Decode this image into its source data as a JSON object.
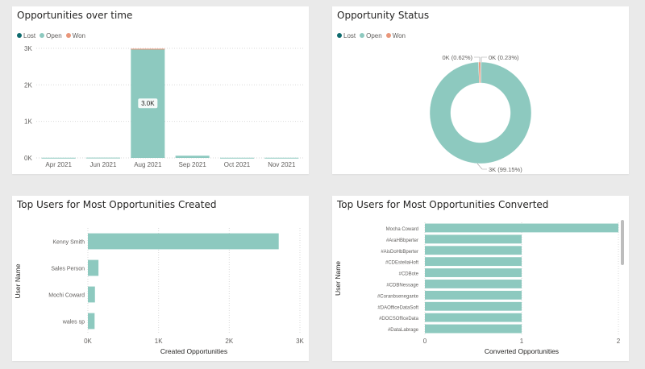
{
  "colors": {
    "lost": "#0e6b6e",
    "open": "#8dc9bf",
    "won": "#e9967a",
    "grid": "#d9d9d9",
    "axis_text": "#605e5c"
  },
  "cards": {
    "opportunities_over_time": {
      "title": "Opportunities over time"
    },
    "opportunity_status": {
      "title": "Opportunity Status"
    },
    "top_created": {
      "title": "Top Users for Most Opportunities Created"
    },
    "top_converted": {
      "title": "Top Users for Most Opportunities Converted"
    }
  },
  "legend": {
    "lost": "Lost",
    "open": "Open",
    "won": "Won"
  },
  "chart_data": [
    {
      "type": "bar",
      "title": "Opportunities over time",
      "categories": [
        "Apr 2021",
        "Jun 2021",
        "Aug 2021",
        "Sep 2021",
        "Oct 2021",
        "Nov 2021"
      ],
      "series": [
        {
          "name": "Lost",
          "values": [
            0,
            0,
            0,
            0,
            0,
            0
          ]
        },
        {
          "name": "Open",
          "values": [
            5,
            8,
            2980,
            60,
            5,
            5
          ]
        },
        {
          "name": "Won",
          "values": [
            0,
            0,
            10,
            0,
            0,
            0
          ]
        }
      ],
      "y_ticks": [
        "0K",
        "1K",
        "2K",
        "3K"
      ],
      "ylim": [
        0,
        3000
      ],
      "data_label": {
        "category": "Aug 2021",
        "text": "3.0K"
      },
      "legend_position": "top-left"
    },
    {
      "type": "pie",
      "title": "Opportunity Status",
      "donut": true,
      "slices": [
        {
          "name": "Open",
          "value": 99.15,
          "label": "3K (99.15%)"
        },
        {
          "name": "Lost",
          "value": 0.23,
          "label": "0K (0.23%)"
        },
        {
          "name": "Won",
          "value": 0.62,
          "label": "0K (0.62%)"
        }
      ],
      "legend_position": "top-left"
    },
    {
      "type": "bar",
      "orientation": "horizontal",
      "title": "Top Users for Most Opportunities Created",
      "ylabel": "User Name",
      "xlabel": "Created Opportunities",
      "categories": [
        "Kenny Smith",
        "Sales Person",
        "Mochi Coward",
        "wales sp"
      ],
      "values": [
        2700,
        150,
        100,
        95
      ],
      "x_ticks": [
        "0K",
        "1K",
        "2K",
        "3K"
      ],
      "xlim": [
        0,
        3000
      ]
    },
    {
      "type": "bar",
      "orientation": "horizontal",
      "title": "Top Users for Most Opportunities Converted",
      "ylabel": "User Name",
      "xlabel": "Converted Opportunities",
      "categories": [
        "Mocha Coward",
        "#AraHBbperter",
        "#AisDoHbBperter",
        "#CDEsteliaHoft",
        "#CDBote",
        "#CDBNessage",
        "#Coranbsenegante",
        "#DAOfficeDataSoft",
        "#DOCSOfficeData",
        "#DataLabrage"
      ],
      "values": [
        2,
        1,
        1,
        1,
        1,
        1,
        1,
        1,
        1,
        1
      ],
      "x_ticks": [
        "0",
        "1",
        "2"
      ],
      "xlim": [
        0,
        2
      ]
    }
  ]
}
